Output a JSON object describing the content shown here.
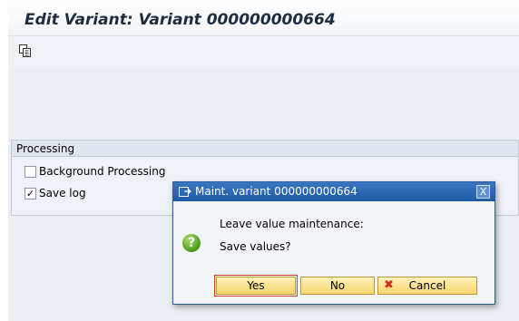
{
  "window": {
    "title": "Edit Variant: Variant 000000000664"
  },
  "toolbar": {
    "icons": [
      {
        "name": "copy-icon"
      }
    ]
  },
  "processing": {
    "title": "Processing",
    "options": [
      {
        "label": "Background Processing",
        "checked": false
      },
      {
        "label": "Save log",
        "checked": true,
        "mark": "✓"
      }
    ]
  },
  "dialog": {
    "title": "Maint. variant 000000000664",
    "close_glyph": "X",
    "icon_glyph": "?",
    "message_line1": "Leave value maintenance:",
    "message_line2": "Save values?",
    "buttons": {
      "yes": "Yes",
      "no": "No",
      "cancel": "Cancel",
      "cancel_glyph": "✖"
    }
  },
  "colors": {
    "title_text": "#1d2d3f",
    "dialog_title_bar": "#1f5aa6",
    "button_fill": "#f8d66f",
    "cancel_icon": "#d22b1d",
    "question_icon": "#4a9a1c"
  }
}
